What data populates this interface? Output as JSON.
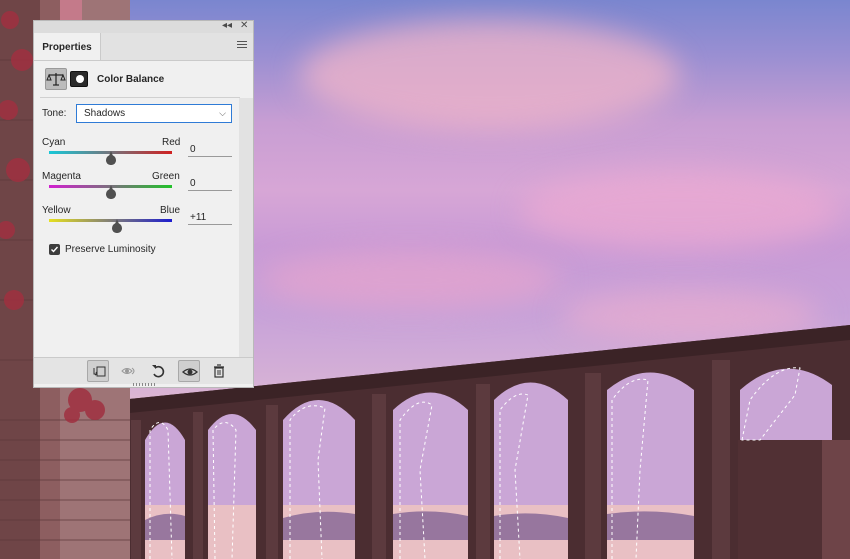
{
  "panel": {
    "tab_label": "Properties",
    "title": "Color Balance",
    "collapse_glyph": "◂◂",
    "close_glyph": "✕",
    "tone": {
      "label": "Tone:",
      "value": "Shadows"
    },
    "sliders": [
      {
        "left_label": "Cyan",
        "right_label": "Red",
        "value": "0",
        "position": 0.5,
        "colors": [
          "#18c8d8",
          "#d02020"
        ]
      },
      {
        "left_label": "Magenta",
        "right_label": "Green",
        "value": "0",
        "position": 0.5,
        "colors": [
          "#d21fd0",
          "#22c22a"
        ]
      },
      {
        "left_label": "Yellow",
        "right_label": "Blue",
        "value": "+11",
        "position": 0.555,
        "colors": [
          "#e6e020",
          "#1c1ccf"
        ]
      }
    ],
    "preserve_luminosity": {
      "label": "Preserve Luminosity",
      "checked": true
    },
    "bottom_icons": [
      "clip-to-layer-icon",
      "view-previous-state-icon",
      "reset-icon",
      "visibility-eye-icon",
      "trash-icon"
    ]
  },
  "colors": {
    "panel_bg": "#f0f0f0",
    "selection_blue": "#2f7bd6",
    "aqueduct": "#4a2c2f"
  }
}
